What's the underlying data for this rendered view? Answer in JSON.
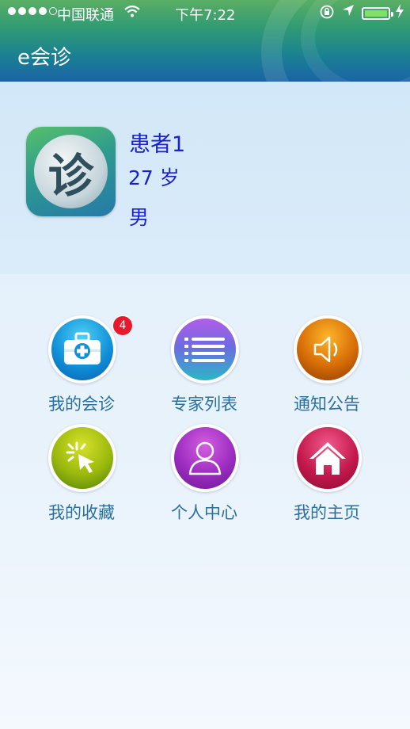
{
  "status_bar": {
    "carrier": "中国联通",
    "time": "下午7:22",
    "wifi_icon": "wifi-icon",
    "signal_dots_filled": 4,
    "signal_dots_total": 5
  },
  "header": {
    "title": "e会诊"
  },
  "patient": {
    "avatar_glyph": "诊",
    "name": "患者1",
    "age": "27 岁",
    "sex": "男"
  },
  "menu": {
    "items": [
      {
        "label": "我的会诊",
        "icon": "medical-kit-icon",
        "badge": "4",
        "color": "#1190d8"
      },
      {
        "label": "专家列表",
        "icon": "list-icon",
        "color": "#6d6be0"
      },
      {
        "label": "通知公告",
        "icon": "speaker-icon",
        "color": "#d66c06"
      },
      {
        "label": "我的收藏",
        "icon": "cursor-click-icon",
        "color": "#9ab80d"
      },
      {
        "label": "个人中心",
        "icon": "person-icon",
        "color": "#9b2cc0"
      },
      {
        "label": "我的主页",
        "icon": "home-icon",
        "color": "#c4184e"
      }
    ]
  },
  "colors": {
    "text_primary": "#1b22c8",
    "menu_label": "#2b6f9e",
    "badge": "#e8192c"
  }
}
